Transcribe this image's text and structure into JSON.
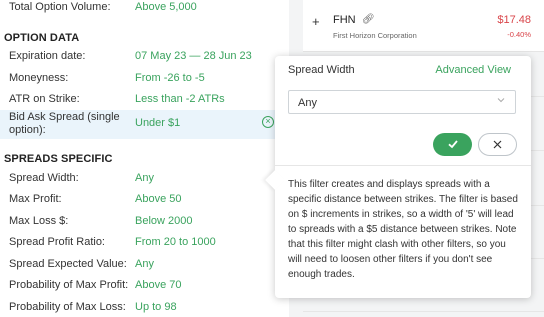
{
  "filters_top": [
    {
      "label": "Total Option Volume:",
      "value": "Above 5,000"
    }
  ],
  "option_data": {
    "heading": "OPTION DATA",
    "rows": [
      {
        "label": "Expiration date:",
        "value": "07 May 23 — 28 Jun 23"
      },
      {
        "label": "Moneyness:",
        "value": "From -26 to -5"
      },
      {
        "label": "ATR on Strike:",
        "value": "Less than -2 ATRs"
      },
      {
        "label": "Bid Ask Spread (single option):",
        "value": "Under $1",
        "active": true
      }
    ]
  },
  "spreads_specific": {
    "heading": "SPREADS SPECIFIC",
    "rows": [
      {
        "label": "Spread Width:",
        "value": "Any"
      },
      {
        "label": "Max Profit:",
        "value": "Above 50"
      },
      {
        "label": "Max Loss $:",
        "value": "Below 2000"
      },
      {
        "label": "Spread Profit Ratio:",
        "value": "From 20 to 1000"
      },
      {
        "label": "Spread Expected Value:",
        "value": "Any"
      },
      {
        "label": "Probability of Max Profit:",
        "value": "Above 70"
      },
      {
        "label": "Probability of Max Loss:",
        "value": "Up to 98"
      }
    ]
  },
  "ticker": {
    "plus": "+",
    "symbol": "FHN",
    "company": "First Horizon Corporation",
    "price": "$17.48",
    "change": "-0.40%"
  },
  "popover": {
    "title": "Spread Width",
    "advanced_link": "Advanced View",
    "select_value": "Any",
    "confirm_icon": "check-icon",
    "cancel_icon": "close-icon",
    "description": "This filter creates and displays spreads with a specific distance between strikes. The filter is based on $ increments in strikes, so a width of '5' will lead to spreads with a $5 distance between strikes. Note that this filter might clash with other filters, so you will need to loosen other filters if you don't see enough trades."
  },
  "colors": {
    "accent_green": "#3aa35e",
    "negative_red": "#d9454a"
  }
}
